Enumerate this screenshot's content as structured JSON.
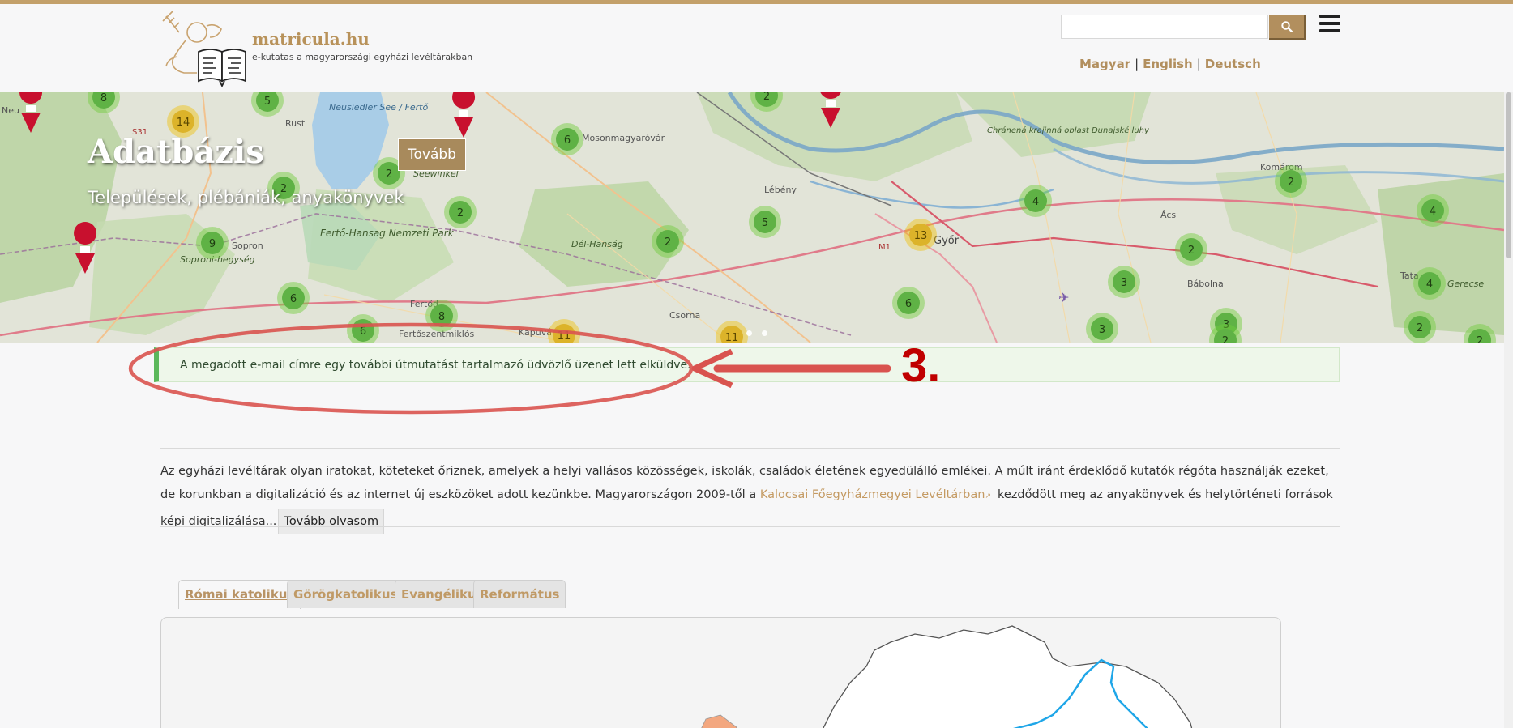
{
  "header": {
    "site_name": "matricula.hu",
    "tagline": "e-kutatas a magyarországi egyházi levéltárakban",
    "search_placeholder": "",
    "languages": [
      "Magyar",
      "English",
      "Deutsch"
    ]
  },
  "hero": {
    "title": "Adatbázis",
    "subtitle": "Települések, plébániák, anyakönyvek",
    "button_label": "Tovább",
    "map_labels": [
      {
        "text": "Rust"
      },
      {
        "text": "Neusiedler See / Fertő"
      },
      {
        "text": "Seewinkel"
      },
      {
        "text": "Fertő-Hansag Nemzeti Park"
      },
      {
        "text": "Sopron"
      },
      {
        "text": "Soproni-hegység"
      },
      {
        "text": "Fertőd"
      },
      {
        "text": "Fertőszentmiklós"
      },
      {
        "text": "Kapuvár"
      },
      {
        "text": "Csorna"
      },
      {
        "text": "Mosonmagyaróvár"
      },
      {
        "text": "Lébény"
      },
      {
        "text": "Dél-Hanság"
      },
      {
        "text": "Győr"
      },
      {
        "text": "M1"
      },
      {
        "text": "S31"
      },
      {
        "text": "Ács"
      },
      {
        "text": "Bábolna"
      },
      {
        "text": "Komárom"
      },
      {
        "text": "Chránená krajinná oblast Dunajské luhy"
      },
      {
        "text": "Gerecse"
      },
      {
        "text": "Tata"
      },
      {
        "text": "Neu"
      }
    ],
    "clusters": [
      {
        "count": "8",
        "kind": "green"
      },
      {
        "count": "5",
        "kind": "green"
      },
      {
        "count": "14",
        "kind": "yellow"
      },
      {
        "count": "6",
        "kind": "green"
      },
      {
        "count": "2",
        "kind": "green"
      },
      {
        "count": "2",
        "kind": "green"
      },
      {
        "count": "2",
        "kind": "green"
      },
      {
        "count": "9",
        "kind": "green"
      },
      {
        "count": "6",
        "kind": "green"
      },
      {
        "count": "8",
        "kind": "green"
      },
      {
        "count": "6",
        "kind": "green"
      },
      {
        "count": "2",
        "kind": "green"
      },
      {
        "count": "2",
        "kind": "green"
      },
      {
        "count": "5",
        "kind": "green"
      },
      {
        "count": "11",
        "kind": "yellow"
      },
      {
        "count": "11",
        "kind": "yellow"
      },
      {
        "count": "13",
        "kind": "yellow"
      },
      {
        "count": "4",
        "kind": "green"
      },
      {
        "count": "6",
        "kind": "green"
      },
      {
        "count": "2",
        "kind": "green"
      },
      {
        "count": "2",
        "kind": "green"
      },
      {
        "count": "3",
        "kind": "green"
      },
      {
        "count": "3",
        "kind": "green"
      },
      {
        "count": "3",
        "kind": "green"
      },
      {
        "count": "2",
        "kind": "green"
      },
      {
        "count": "4",
        "kind": "green"
      },
      {
        "count": "4",
        "kind": "green"
      },
      {
        "count": "2",
        "kind": "green"
      },
      {
        "count": "2",
        "kind": "green"
      }
    ]
  },
  "alert": {
    "message": "A megadott e-mail címre egy további útmutatást tartalmazó üdvözlő üzenet lett elküldve.",
    "annotation": "3."
  },
  "intro": {
    "text_before_link": "Az egyházi levéltárak olyan iratokat, köteteket őriznek, amelyek a helyi vallásos közösségek, iskolák, családok életének egyedülálló emlékei. A múlt iránt érdeklődő kutatók régóta használják ezeket, de korunkban a digitalizáció és az internet új eszközöket adott kezünkbe. Magyarországon 2009-től a ",
    "link_text": "Kalocsai Főegyházmegyei Levéltárban",
    "text_after_link": "kezdődött meg az anyakönyvek és helytörténeti források képi digitalizálása...",
    "read_more_label": "Tovább olvasom"
  },
  "tabs": [
    {
      "label": "Római katolikus",
      "active": true
    },
    {
      "label": "Görögkatolikus",
      "active": false
    },
    {
      "label": "Evangélikus",
      "active": false
    },
    {
      "label": "Református",
      "active": false
    }
  ],
  "colors": {
    "accent": "#b28f5e",
    "top_bar": "#c3a06a",
    "alert_bg": "#eef7ea",
    "alert_border": "#5cb85c",
    "annotation": "#c00000"
  }
}
